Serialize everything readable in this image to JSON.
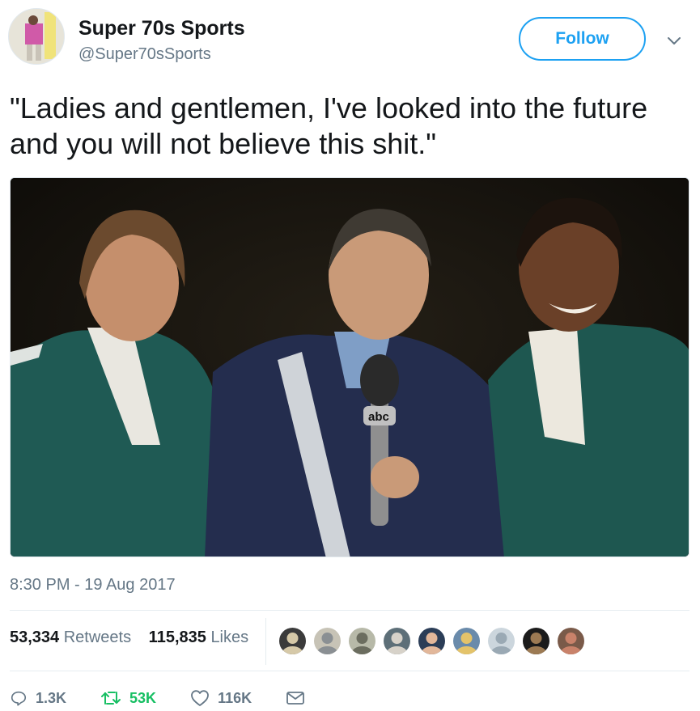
{
  "tweet": {
    "author_name": "Super 70s Sports",
    "author_handle": "@Super70sSports",
    "follow_label": "Follow",
    "text": "\"Ladies and gentlemen, I've looked into the future and you will not believe this shit.\"",
    "timestamp": "8:30 PM - 19 Aug 2017",
    "media_logo_text": "abc"
  },
  "stats": {
    "retweets_count": "53,334",
    "retweets_label": "Retweets",
    "likes_count": "115,835",
    "likes_label": "Likes"
  },
  "actions": {
    "reply_count": "1.3K",
    "retweet_count": "53K",
    "like_count": "116K"
  },
  "icons": {
    "reply": "reply-icon",
    "retweet": "retweet-icon",
    "like": "heart-icon",
    "dm": "envelope-icon",
    "more": "chevron-down-icon"
  },
  "colors": {
    "accent": "#1da1f2",
    "retweet_green": "#17bf63",
    "secondary_text": "#657786",
    "primary_text": "#14171a"
  },
  "liker_avatars": [
    {
      "name": "liker-avatar-1",
      "bg": "#3b3b3b",
      "fg": "#d6c9a8"
    },
    {
      "name": "liker-avatar-2",
      "bg": "#c7c3b6",
      "fg": "#8a8f93"
    },
    {
      "name": "liker-avatar-3",
      "bg": "#b7b9a8",
      "fg": "#6b6d5f"
    },
    {
      "name": "liker-avatar-4",
      "bg": "#5d6f78",
      "fg": "#d7d2c9"
    },
    {
      "name": "liker-avatar-5",
      "bg": "#2b3d57",
      "fg": "#e2b79a"
    },
    {
      "name": "liker-avatar-6",
      "bg": "#6a8bab",
      "fg": "#e4c36a"
    },
    {
      "name": "liker-avatar-7",
      "bg": "#ccd6dd",
      "fg": "#9aa9b4"
    },
    {
      "name": "liker-avatar-8",
      "bg": "#1b1b1b",
      "fg": "#9c7a53"
    },
    {
      "name": "liker-avatar-9",
      "bg": "#7a5a49",
      "fg": "#c9826a"
    }
  ]
}
